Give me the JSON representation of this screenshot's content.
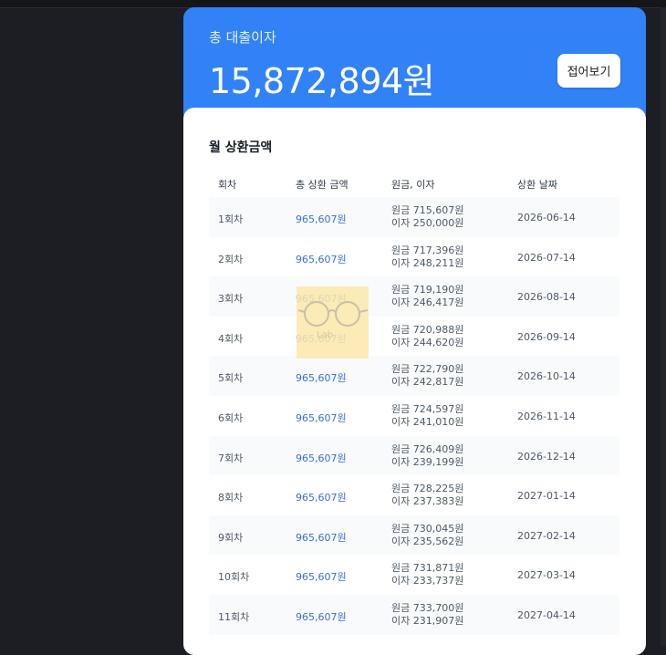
{
  "summary": {
    "label": "총 대출이자",
    "total": "15,872,894원",
    "collapse_button": "접어보기"
  },
  "schedule": {
    "title": "월 상환금액",
    "headers": [
      "회차",
      "총 상환 금액",
      "원금, 이자",
      "상환 날짜"
    ],
    "rows": [
      {
        "no": "1회차",
        "total": "965,607원",
        "principal": "원금 715,607원",
        "interest": "이자 250,000원",
        "date": "2026-06-14"
      },
      {
        "no": "2회차",
        "total": "965,607원",
        "principal": "원금 717,396원",
        "interest": "이자 248,211원",
        "date": "2026-07-14"
      },
      {
        "no": "3회차",
        "total": "965,607원",
        "principal": "원금 719,190원",
        "interest": "이자 246,417원",
        "date": "2026-08-14"
      },
      {
        "no": "4회차",
        "total": "965,607원",
        "principal": "원금 720,988원",
        "interest": "이자 244,620원",
        "date": "2026-09-14"
      },
      {
        "no": "5회차",
        "total": "965,607원",
        "principal": "원금 722,790원",
        "interest": "이자 242,817원",
        "date": "2026-10-14"
      },
      {
        "no": "6회차",
        "total": "965,607원",
        "principal": "원금 724,597원",
        "interest": "이자 241,010원",
        "date": "2026-11-14"
      },
      {
        "no": "7회차",
        "total": "965,607원",
        "principal": "원금 726,409원",
        "interest": "이자 239,199원",
        "date": "2026-12-14"
      },
      {
        "no": "8회차",
        "total": "965,607원",
        "principal": "원금 728,225원",
        "interest": "이자 237,383원",
        "date": "2027-01-14"
      },
      {
        "no": "9회차",
        "total": "965,607원",
        "principal": "원금 730,045원",
        "interest": "이자 235,562원",
        "date": "2027-02-14"
      },
      {
        "no": "10회차",
        "total": "965,607원",
        "principal": "원금 731,871원",
        "interest": "이자 233,737원",
        "date": "2027-03-14"
      },
      {
        "no": "11회차",
        "total": "965,607원",
        "principal": "원금 733,700원",
        "interest": "이자 231,907원",
        "date": "2027-04-14"
      }
    ]
  },
  "watermark": {
    "text": "Lab",
    "icon": "glasses-icon"
  },
  "colors": {
    "accent": "#3182f6",
    "amount": "#3a6fd8",
    "background": "#1d1e24"
  }
}
